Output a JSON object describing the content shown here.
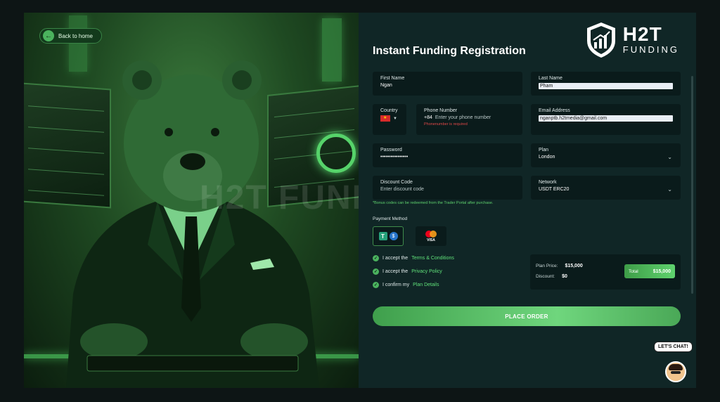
{
  "hero": {
    "back_label": "Back to home",
    "watermark": "H2T FUNDING"
  },
  "brand": {
    "name": "H2T",
    "tagline": "FUNDING"
  },
  "form": {
    "title": "Instant Funding Registration",
    "first_name": {
      "label": "First Name",
      "value": "Ngan"
    },
    "last_name": {
      "label": "Last Name",
      "value": "Pham"
    },
    "country": {
      "label": "Country",
      "flag": "vietnam-flag"
    },
    "phone": {
      "label": "Phone Number",
      "code": "+84",
      "placeholder": "Enter your phone number",
      "error": "Phonenumber is required"
    },
    "email": {
      "label": "Email Address",
      "value": "nganptb.h2tmedia@gmail.com"
    },
    "password": {
      "label": "Password",
      "value": "••••••••••••••••"
    },
    "plan": {
      "label": "Plan",
      "value": "London"
    },
    "discount": {
      "label": "Discount Code",
      "placeholder": "Enter discount code"
    },
    "network": {
      "label": "Network",
      "value": "USDT ERC20"
    },
    "bonus_note": "*Bonus codes can be redeemed from the Trader Portal after purchase.",
    "payment_label": "Payment Method",
    "payment_methods": [
      "tether-usdc",
      "mastercard-visa"
    ],
    "visa_text": "VISA",
    "agreements": [
      {
        "text": "I accept the",
        "link": "Terms & Conditions"
      },
      {
        "text": "I accept the",
        "link": "Privacy Policy"
      },
      {
        "text": "I confirm my",
        "link": "Plan Details"
      }
    ],
    "summary": {
      "plan_price_label": "Plan Price:",
      "plan_price": "$15,000",
      "discount_label": "Discount:",
      "discount": "$0",
      "total_label": "Total",
      "total": "$15,000"
    },
    "submit_label": "PLACE ORDER"
  },
  "chat": {
    "label": "LET'S CHAT!"
  },
  "colors": {
    "accent": "#5fd26e",
    "panel": "#102626",
    "field": "#0a1b1b",
    "error": "#e04848"
  }
}
